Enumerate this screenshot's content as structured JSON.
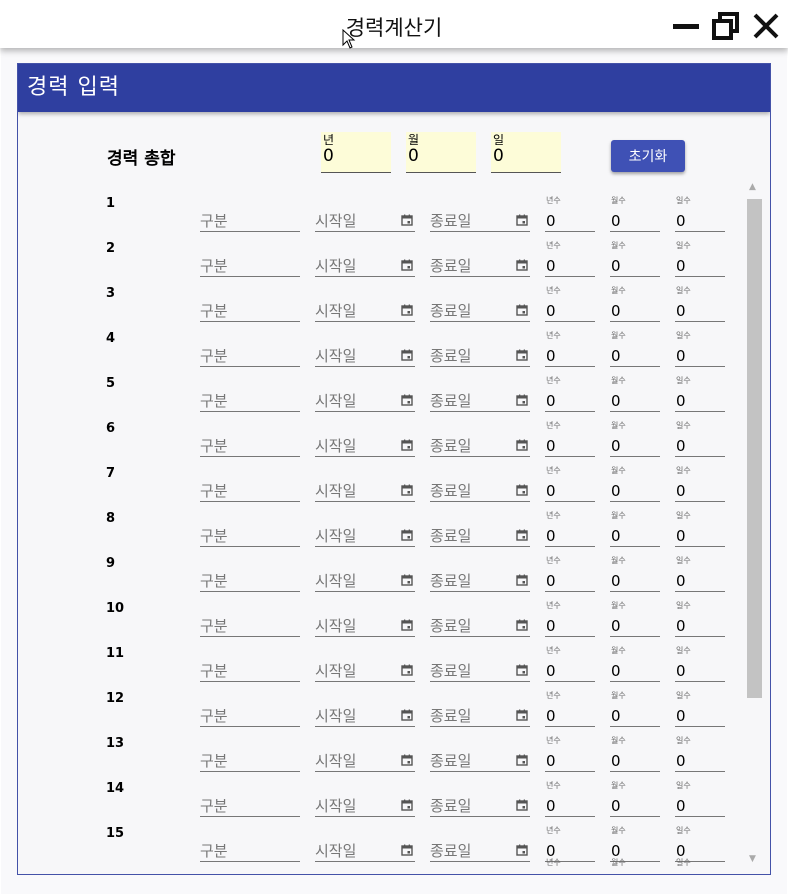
{
  "window": {
    "title": "경력계산기"
  },
  "card": {
    "header": "경력 입력"
  },
  "summary": {
    "label": "경력 총합",
    "years_label": "년",
    "years_value": "0",
    "months_label": "월",
    "months_value": "0",
    "days_label": "일",
    "days_value": "0",
    "reset_label": "초기화"
  },
  "row_labels": {
    "category_placeholder": "구분",
    "start_placeholder": "시작일",
    "end_placeholder": "종료일",
    "years_caption": "년수",
    "months_caption": "월수",
    "days_caption": "일수"
  },
  "rows": [
    {
      "num": "1",
      "years": "0",
      "months": "0",
      "days": "0"
    },
    {
      "num": "2",
      "years": "0",
      "months": "0",
      "days": "0"
    },
    {
      "num": "3",
      "years": "0",
      "months": "0",
      "days": "0"
    },
    {
      "num": "4",
      "years": "0",
      "months": "0",
      "days": "0"
    },
    {
      "num": "5",
      "years": "0",
      "months": "0",
      "days": "0"
    },
    {
      "num": "6",
      "years": "0",
      "months": "0",
      "days": "0"
    },
    {
      "num": "7",
      "years": "0",
      "months": "0",
      "days": "0"
    },
    {
      "num": "8",
      "years": "0",
      "months": "0",
      "days": "0"
    },
    {
      "num": "9",
      "years": "0",
      "months": "0",
      "days": "0"
    },
    {
      "num": "10",
      "years": "0",
      "months": "0",
      "days": "0"
    },
    {
      "num": "11",
      "years": "0",
      "months": "0",
      "days": "0"
    },
    {
      "num": "12",
      "years": "0",
      "months": "0",
      "days": "0"
    },
    {
      "num": "13",
      "years": "0",
      "months": "0",
      "days": "0"
    },
    {
      "num": "14",
      "years": "0",
      "months": "0",
      "days": "0"
    },
    {
      "num": "15",
      "years": "0",
      "months": "0",
      "days": "0"
    }
  ],
  "icons": {
    "minimize": "minimize-icon",
    "maximize": "restore-icon",
    "close": "close-icon",
    "calendar": "calendar-icon",
    "cursor": "mouse-cursor-icon"
  },
  "colors": {
    "header": "#2f3fa0",
    "button": "#3f51b5",
    "summary_field": "#fdfcd8"
  }
}
